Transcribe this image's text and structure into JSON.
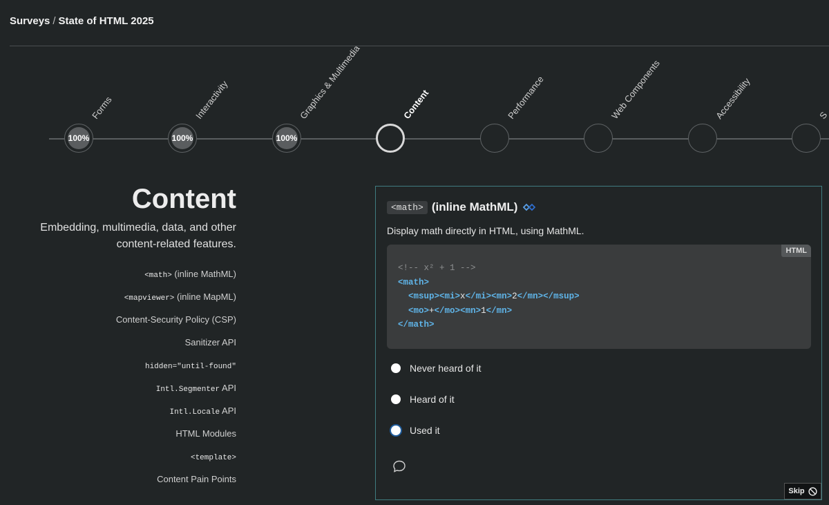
{
  "breadcrumb": {
    "root": "Surveys",
    "separator": "/",
    "current": "State of HTML 2025"
  },
  "steps": [
    {
      "label": "Forms",
      "progress": "100%",
      "state": "done"
    },
    {
      "label": "Interactivity",
      "progress": "100%",
      "state": "done"
    },
    {
      "label": "Graphics & Multimedia",
      "progress": "100%",
      "state": "done"
    },
    {
      "label": "Content",
      "progress": "",
      "state": "current"
    },
    {
      "label": "Performance",
      "progress": "",
      "state": "todo"
    },
    {
      "label": "Web Components",
      "progress": "",
      "state": "todo"
    },
    {
      "label": "Accessibility",
      "progress": "",
      "state": "todo"
    },
    {
      "label": "S",
      "progress": "",
      "state": "todo"
    }
  ],
  "section": {
    "title": "Content",
    "description": "Embedding, multimedia, data, and other content-related features."
  },
  "questions": [
    {
      "code": "<math>",
      "text": " (inline MathML)"
    },
    {
      "code": "<mapviewer>",
      "text": " (inline MapML)"
    },
    {
      "code": "",
      "text": "Content-Security Policy (CSP)"
    },
    {
      "code": "",
      "text": "Sanitizer API"
    },
    {
      "code": "hidden=\"until-found\"",
      "text": ""
    },
    {
      "code": "Intl.Segmenter",
      "text": " API"
    },
    {
      "code": "Intl.Locale",
      "text": " API"
    },
    {
      "code": "",
      "text": "HTML Modules"
    },
    {
      "code": "<template>",
      "text": ""
    },
    {
      "code": "",
      "text": "Content Pain Points"
    }
  ],
  "card": {
    "code_label": "<math>",
    "title": "(inline MathML)",
    "badge_icon": "baseline-status-icon",
    "description": "Display math directly in HTML, using MathML.",
    "code_lang": "HTML",
    "code_lines": [
      "<!-- x² + 1 -->",
      "<math>",
      "  <msup><mi>x</mi><mn>2</mn></msup>",
      "  <mo>+</mo><mn>1</mn>",
      "</math>"
    ],
    "options": [
      "Never heard of it",
      "Heard of it",
      "Used it"
    ],
    "comment_icon": "comment-icon",
    "skip_label": "Skip",
    "skip_icon": "no-entry-icon"
  },
  "colors": {
    "background": "#212526",
    "card_border": "#3f7d80",
    "tag": "#5fb4e8",
    "comment": "#8d8f90",
    "focus": "#1f5c9c"
  }
}
